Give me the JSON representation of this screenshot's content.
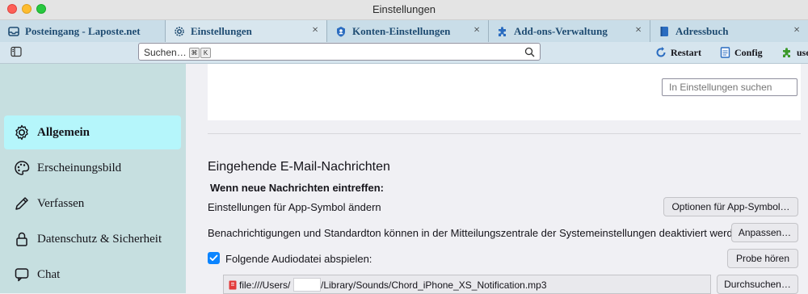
{
  "window": {
    "title": "Einstellungen"
  },
  "tabs": [
    {
      "label": "Posteingang - Laposte.net",
      "icon": "inbox-icon",
      "closable": false
    },
    {
      "label": "Einstellungen",
      "icon": "gear-icon",
      "closable": true
    },
    {
      "label": "Konten-Einstellungen",
      "icon": "account-icon",
      "closable": true
    },
    {
      "label": "Add-ons-Verwaltung",
      "icon": "puzzle-icon",
      "closable": true
    },
    {
      "label": "Adressbuch",
      "icon": "addressbook-icon",
      "closable": true
    }
  ],
  "tab_close_glyph": "×",
  "toolbar": {
    "search_placeholder": "Suchen…",
    "shortcut_keys": [
      "⌘",
      "K"
    ],
    "restart_label": "Restart",
    "config_label": "Config",
    "extra_label": "use"
  },
  "sidebar": {
    "items": [
      {
        "label": "Allgemein",
        "icon": "gear-icon",
        "active": true
      },
      {
        "label": "Erscheinungsbild",
        "icon": "palette-icon",
        "active": false
      },
      {
        "label": "Verfassen",
        "icon": "pencil-icon",
        "active": false
      },
      {
        "label": "Datenschutz & Sicherheit",
        "icon": "lock-icon",
        "active": false
      },
      {
        "label": "Chat",
        "icon": "chat-icon",
        "active": false
      }
    ]
  },
  "content": {
    "find_placeholder": "In Einstellungen suchen",
    "section_title": "Eingehende E-Mail-Nachrichten",
    "subheading": "Wenn neue Nachrichten eintreffen:",
    "row_app_icon": {
      "label": "Einstellungen für App-Symbol ändern",
      "button": "Optionen für App-Symbol…"
    },
    "row_notifications": {
      "label": "Benachrichtigungen und Standardton können in der Mitteilungszentrale der Systemeinstellungen deaktiviert werden.",
      "button": "Anpassen…"
    },
    "row_audio": {
      "label": "Folgende Audiodatei abspielen:",
      "checked": true,
      "button": "Probe hören"
    },
    "file_path": {
      "prefix": "file:///Users/",
      "suffix": "/Library/Sounds/Chord_iPhone_XS_Notification.mp3",
      "button": "Durchsuchen…"
    }
  },
  "colors": {
    "accent": "#0a84ff",
    "sidebar_bg": "#c6dfe0",
    "active_nav_bg": "#b5f6fb",
    "tab_text": "#1f4c72"
  }
}
